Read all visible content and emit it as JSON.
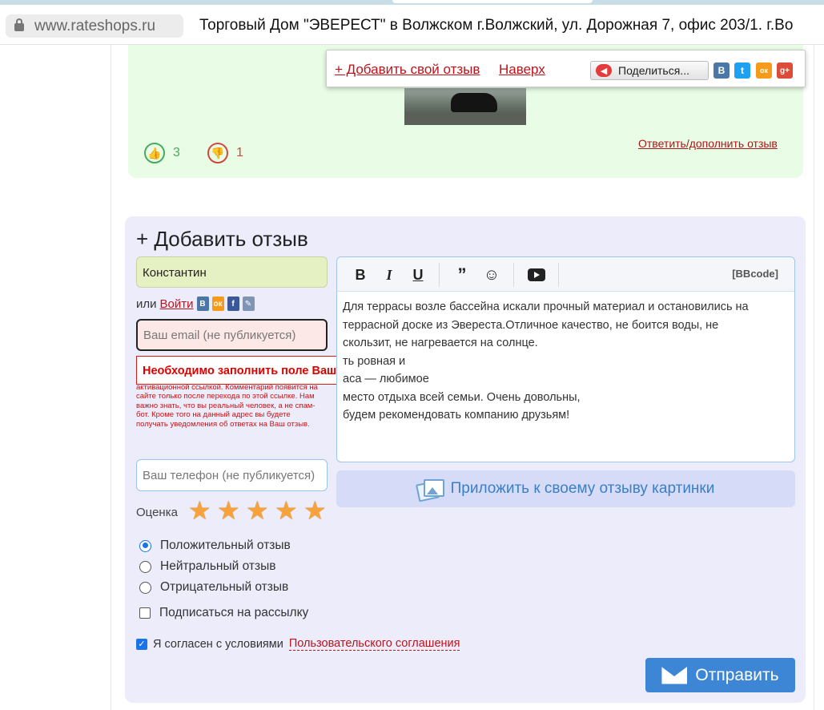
{
  "browser": {
    "url": "www.rateshops.ru",
    "title": "Торговый Дом \"ЭВЕРЕСТ\" в Волжском г.Волжский, ул. Дорожная 7, офис 203/1. г.Во"
  },
  "previous_review": {
    "likes": "3",
    "dislikes": "1",
    "reply_link": "Ответить/дополнить отзыв"
  },
  "floating_bar": {
    "add_review_link": "+ Добавить свой отзыв",
    "top_link": "Наверх",
    "share_button": "Поделиться...",
    "social": [
      "В",
      "t",
      "ок",
      "g+"
    ]
  },
  "form": {
    "title": "+ Добавить отзыв",
    "name_value": "Константин",
    "or_text": "или",
    "login_link": "Войти",
    "email_placeholder": "Ваш email (не публикуется)",
    "error_message": "Необходимо заполнить поле Ваш email (не публикуется).",
    "email_help": "адрес! На данный адрес будет отправлено письмо с активационной ссылкой. Комментарий появится на сайте только после перехода по этой ссылке. Нам важно знать, что вы реальный человек, а не спам-бот. Кроме того на данный адрес вы будете получать уведомления об ответах на Ваш отзыв.",
    "phone_placeholder": "Ваш телефон (не публикуется)",
    "rating_label": "Оценка",
    "rating_value": 5,
    "radio_positive": "Положительный отзыв",
    "radio_neutral": "Нейтральный отзыв",
    "radio_negative": "Отрицательный отзыв",
    "subscribe": "Подписаться на рассылку",
    "agree_text": "Я согласен с условиями",
    "agree_link": "Пользовательского соглашения",
    "editor_bbcode": "[BBcode]",
    "editor_text": " Для террасы возле бассейна искали прочный материал и остановились на\nтеррасной доске из Эвереста.Отличное качество, не боится воды, не\nскользит, не нагревается на солнце.\n                                                ть ровная и\n                                                аса — любимое\nместо отдыха всей семьи. Очень довольны,\nбудем рекомендовать компанию друзьям!",
    "attach_label": "Приложить к своему отзыву картинки",
    "submit_label": "Отправить"
  },
  "colors": {
    "review_bg": "#e9fde6",
    "form_bg": "#ececfb",
    "link_red": "#c0121b",
    "submit_blue": "#3d86d6",
    "error_red": "#e00000"
  }
}
